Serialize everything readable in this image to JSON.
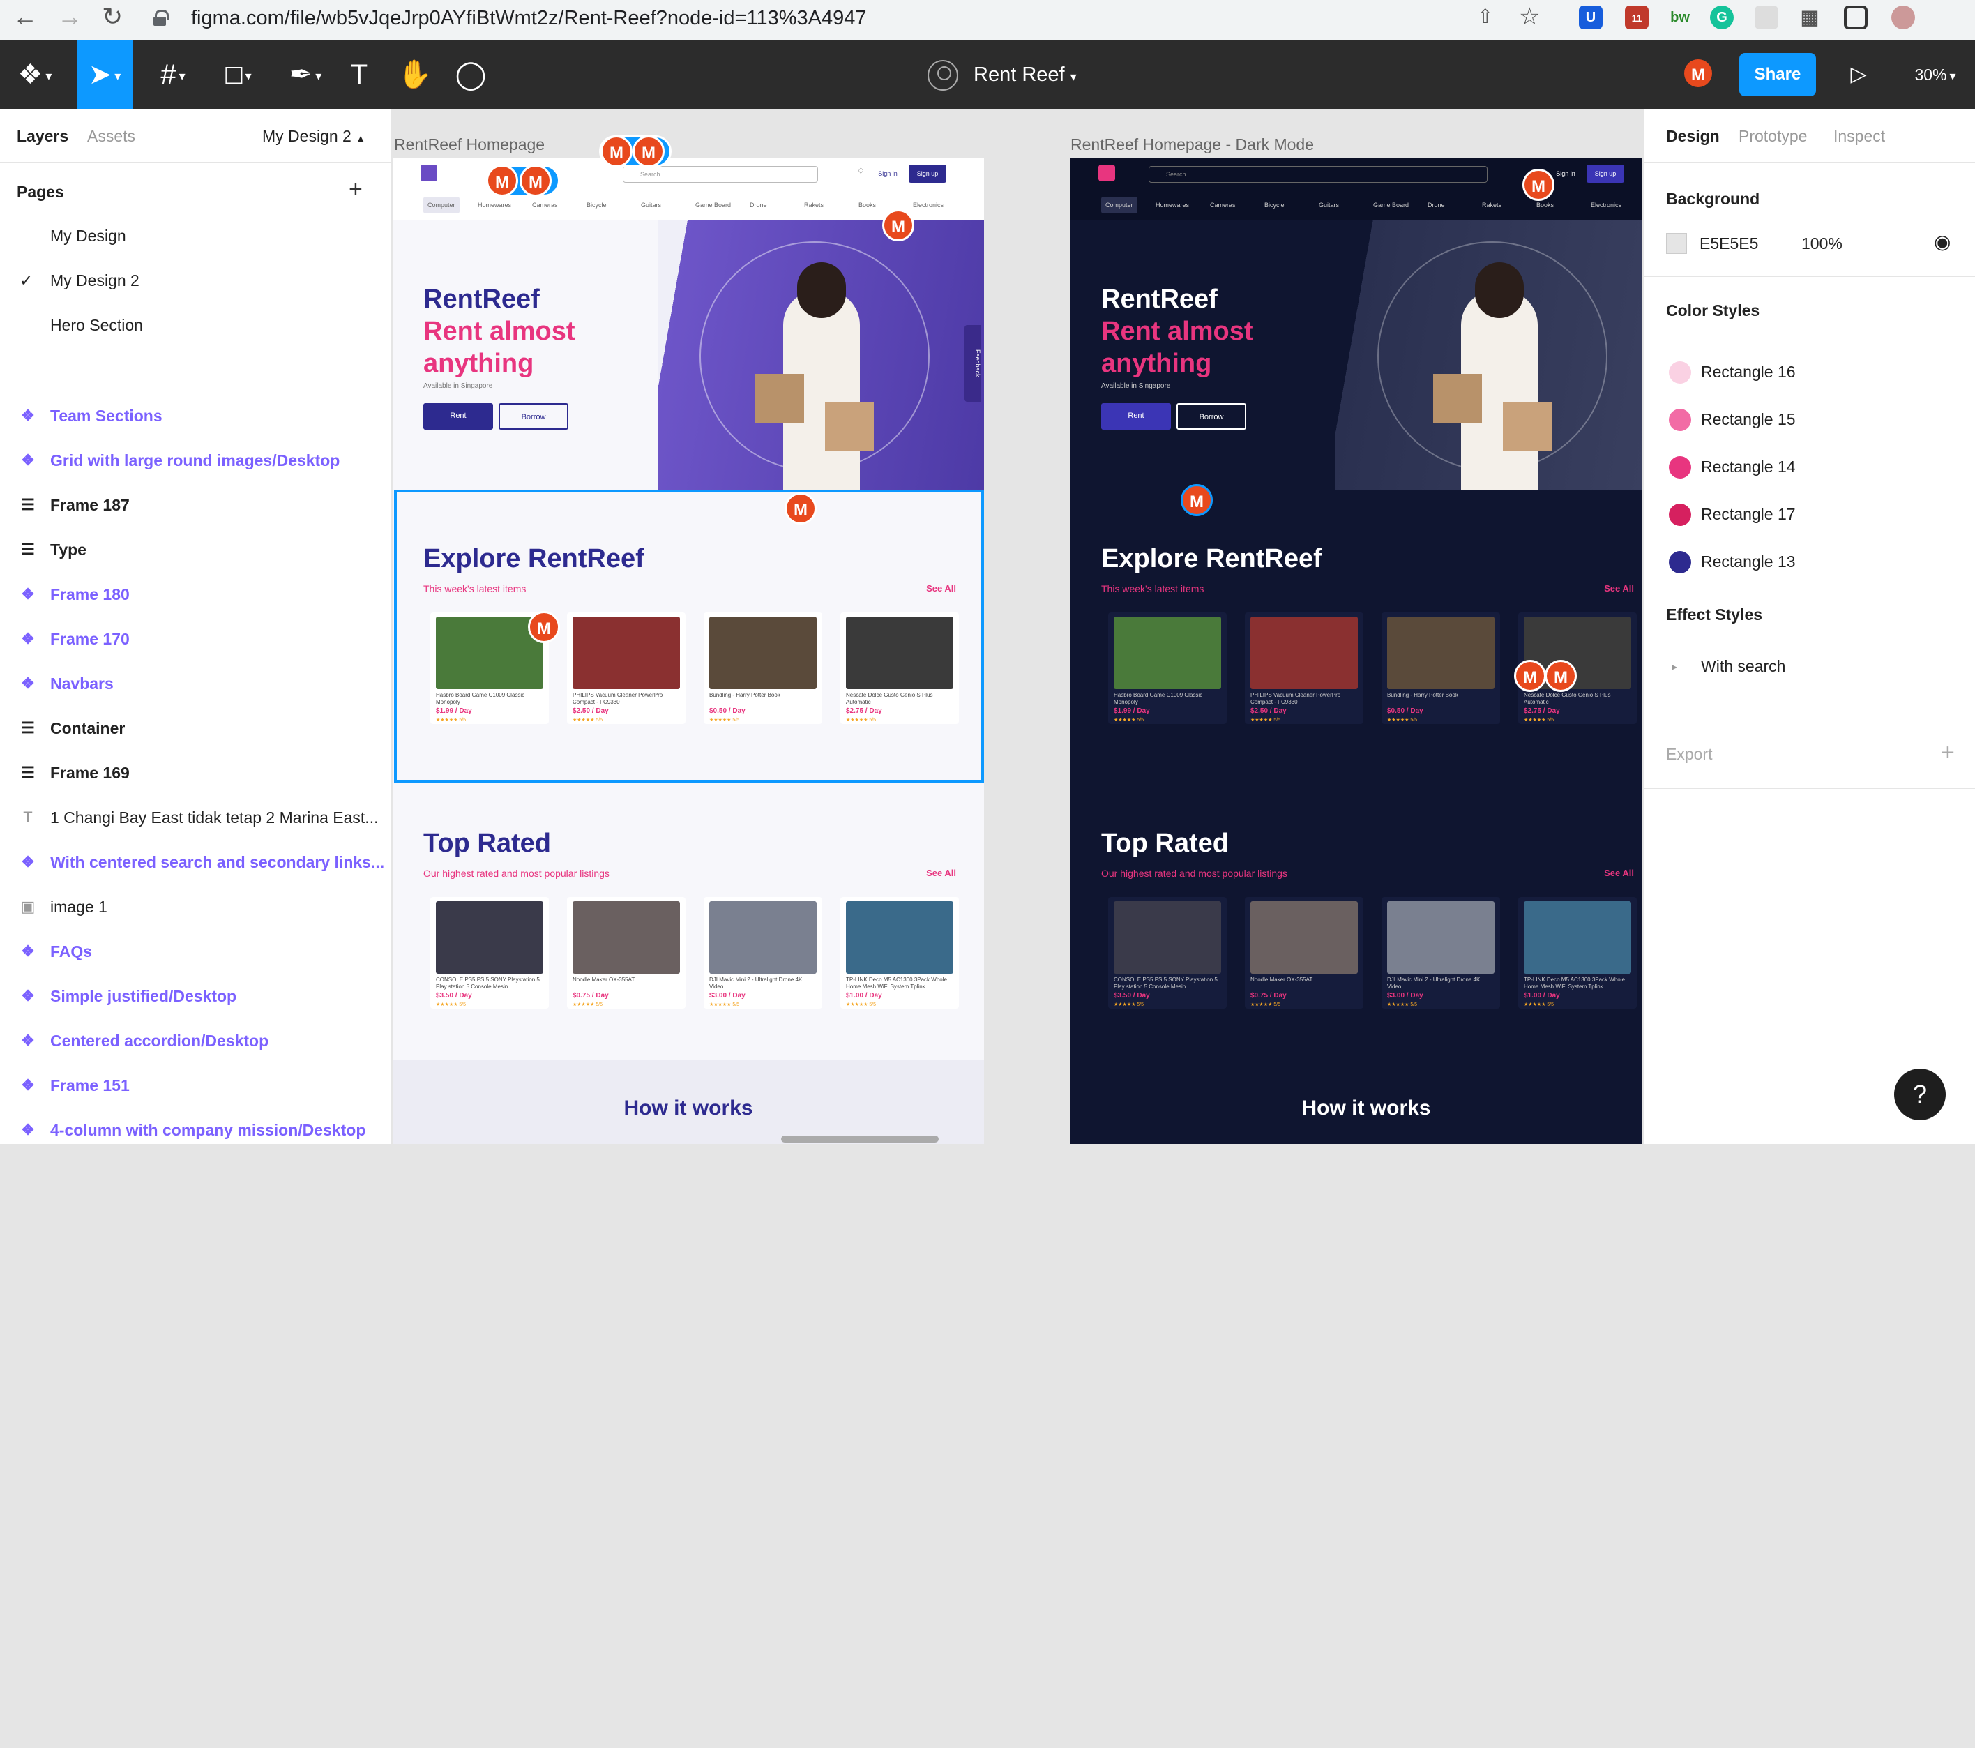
{
  "browser": {
    "url": "figma.com/file/wb5vJqeJrp0AYfiBtWmt2z/Rent-Reef?node-id=113%3A4947",
    "ext_badge": "11",
    "ext_bw": "bw"
  },
  "toolbar": {
    "doc_title": "Rent Reef",
    "user_initial": "M",
    "share_label": "Share",
    "zoom": "30%"
  },
  "left_panel": {
    "tabs": [
      "Layers",
      "Assets"
    ],
    "current_page_label": "My Design 2",
    "pages_header": "Pages",
    "pages": [
      "My Design",
      "My Design 2",
      "Hero Section"
    ],
    "selected_page_check": "✓",
    "layers": [
      {
        "label": "Team Sections",
        "kind": "comp"
      },
      {
        "label": "Grid with large round images/Desktop",
        "kind": "comp"
      },
      {
        "label": "Frame 187",
        "kind": "frame"
      },
      {
        "label": "Type",
        "kind": "frame"
      },
      {
        "label": "Frame 180",
        "kind": "comp"
      },
      {
        "label": "Frame 170",
        "kind": "comp"
      },
      {
        "label": "Navbars",
        "kind": "comp"
      },
      {
        "label": "Container",
        "kind": "frame"
      },
      {
        "label": "Frame 169",
        "kind": "frame"
      },
      {
        "label": "1 Changi Bay East tidak tetap 2 Marina East...",
        "kind": "text"
      },
      {
        "label": "With centered search and secondary links...",
        "kind": "comp"
      },
      {
        "label": "image 1",
        "kind": "image"
      },
      {
        "label": "FAQs",
        "kind": "comp"
      },
      {
        "label": "Simple justified/Desktop",
        "kind": "comp"
      },
      {
        "label": "Centered accordion/Desktop",
        "kind": "comp"
      },
      {
        "label": "Frame 151",
        "kind": "comp"
      },
      {
        "label": "4-column with company mission/Desktop",
        "kind": "comp"
      }
    ]
  },
  "canvas": {
    "light_label": "RentReef Homepage",
    "dark_label": "RentReef  Homepage - Dark Mode",
    "nav": {
      "search_placeholder": "Search",
      "sign_in": "Sign in",
      "sign_up": "Sign up",
      "categories_light": [
        "Computer",
        "Homewares",
        "Cameras",
        "Bicycle",
        "Guitars",
        "Game Board",
        "Drone",
        "Rakets",
        "Books",
        "Electronics"
      ],
      "categories_dark": [
        "Computer",
        "Homewares",
        "Cameras",
        "Bicycle",
        "Guitars",
        "Game Board",
        "Drone",
        "Rakets",
        "Books",
        "Electronics"
      ]
    },
    "hero": {
      "title": "RentReef",
      "subtitle_1": "Rent almost",
      "subtitle_2": "anything",
      "available": "Available in Singapore",
      "rent_btn": "Rent",
      "borrow_btn": "Borrow",
      "feedback": "Feedback"
    },
    "explore": {
      "title": "Explore RentReef",
      "sub": "This week's latest items",
      "see_all": "See All",
      "items": [
        {
          "name": "Hasbro Board Game C1009 Classic Monopoly",
          "price": "$1.99 / Day",
          "color": "#4a7a3a"
        },
        {
          "name": "PHILIPS Vacuum Cleaner PowerPro Compact - FC9330",
          "price": "$2.50 / Day",
          "color": "#8a3030"
        },
        {
          "name": "Bundling - Harry Potter Book",
          "price": "$0.50 / Day",
          "color": "#5a4a3a"
        },
        {
          "name": "Nescafe Dolce Gusto Genio S Plus Automatic",
          "price": "$2.75 / Day",
          "color": "#3a3a3a"
        }
      ]
    },
    "top_rated": {
      "title": "Top Rated",
      "sub": "Our highest rated and most popular listings",
      "see_all": "See All",
      "items": [
        {
          "name": "CONSOLE PS5 PS 5 SONY Playstation 5 Play station 5 Console Mesin",
          "price": "$3.50 / Day",
          "color": "#3a3a4a"
        },
        {
          "name": "Noodle Maker OX-355AT",
          "price": "$0.75 / Day",
          "color": "#6a6060"
        },
        {
          "name": "DJI Mavic Mini 2 - Ultralight Drone 4K Video",
          "price": "$3.00 / Day",
          "color": "#7a8090"
        },
        {
          "name": "TP-LINK Deco M5 AC1300 3Pack Whole Home Mesh WiFi System Tplink",
          "price": "$1.00 / Day",
          "color": "#3a6a8a"
        }
      ]
    },
    "how_it_works": "How it works",
    "rating": "★★★★★ 5/5",
    "cursor_initial": "M"
  },
  "right_panel": {
    "tabs": [
      "Design",
      "Prototype",
      "Inspect"
    ],
    "background_header": "Background",
    "background_hex": "E5E5E5",
    "background_opacity": "100%",
    "color_styles_header": "Color Styles",
    "color_styles": [
      {
        "label": "Rectangle 16",
        "color": "#fad1e3"
      },
      {
        "label": "Rectangle 15",
        "color": "#f26ba5"
      },
      {
        "label": "Rectangle 14",
        "color": "#e8357f"
      },
      {
        "label": "Rectangle 17",
        "color": "#d6205f"
      },
      {
        "label": "Rectangle 13",
        "color": "#2d2a8f"
      }
    ],
    "effect_styles_header": "Effect Styles",
    "effect_styles": [
      "With search"
    ],
    "export_header": "Export"
  },
  "help": "?"
}
